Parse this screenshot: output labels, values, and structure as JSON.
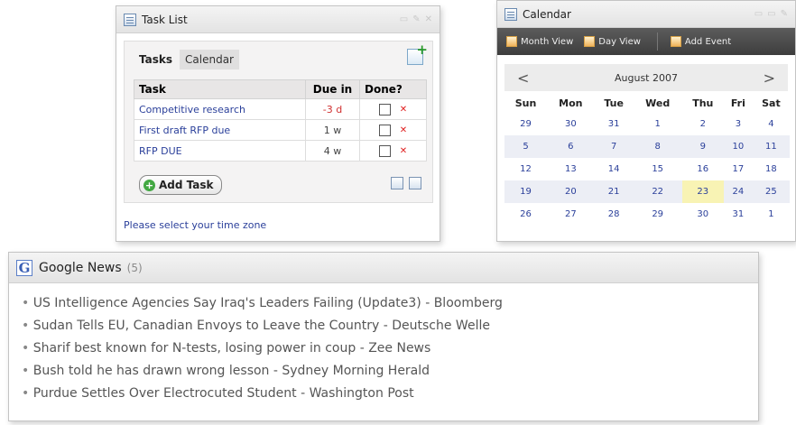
{
  "task_list": {
    "title": "Task List",
    "tabs": [
      "Tasks",
      "Calendar"
    ],
    "columns": [
      "Task",
      "Due in",
      "Done?"
    ],
    "rows": [
      {
        "task": "Competitive research",
        "due": "-3 d",
        "overdue": true
      },
      {
        "task": "First draft RFP due",
        "due": "1 w",
        "overdue": false
      },
      {
        "task": "RFP DUE",
        "due": "4 w",
        "overdue": false
      }
    ],
    "add_task_label": "Add Task",
    "timezone_link": "Please select your time zone"
  },
  "calendar": {
    "title": "Calendar",
    "toolbar": [
      "Month View",
      "Day View",
      "Add Event"
    ],
    "month_label": "August 2007",
    "weekdays": [
      "Sun",
      "Mon",
      "Tue",
      "Wed",
      "Thu",
      "Fri",
      "Sat"
    ],
    "weeks": [
      [
        "29",
        "30",
        "31",
        "1",
        "2",
        "3",
        "4"
      ],
      [
        "5",
        "6",
        "7",
        "8",
        "9",
        "10",
        "11"
      ],
      [
        "12",
        "13",
        "14",
        "15",
        "16",
        "17",
        "18"
      ],
      [
        "19",
        "20",
        "21",
        "22",
        "23",
        "24",
        "25"
      ],
      [
        "26",
        "27",
        "28",
        "29",
        "30",
        "31",
        "1"
      ]
    ],
    "today": "23"
  },
  "news": {
    "title": "Google News",
    "count": "(5)",
    "items": [
      "US Intelligence Agencies Say Iraq's Leaders Failing (Update3) - Bloomberg",
      "Sudan Tells EU, Canadian Envoys to Leave the Country - Deutsche Welle",
      "Sharif best known for N-tests, losing power in coup - Zee News",
      "Bush told he has drawn wrong lesson - Sydney Morning Herald",
      "Purdue Settles Over Electrocuted Student - Washington Post"
    ]
  }
}
